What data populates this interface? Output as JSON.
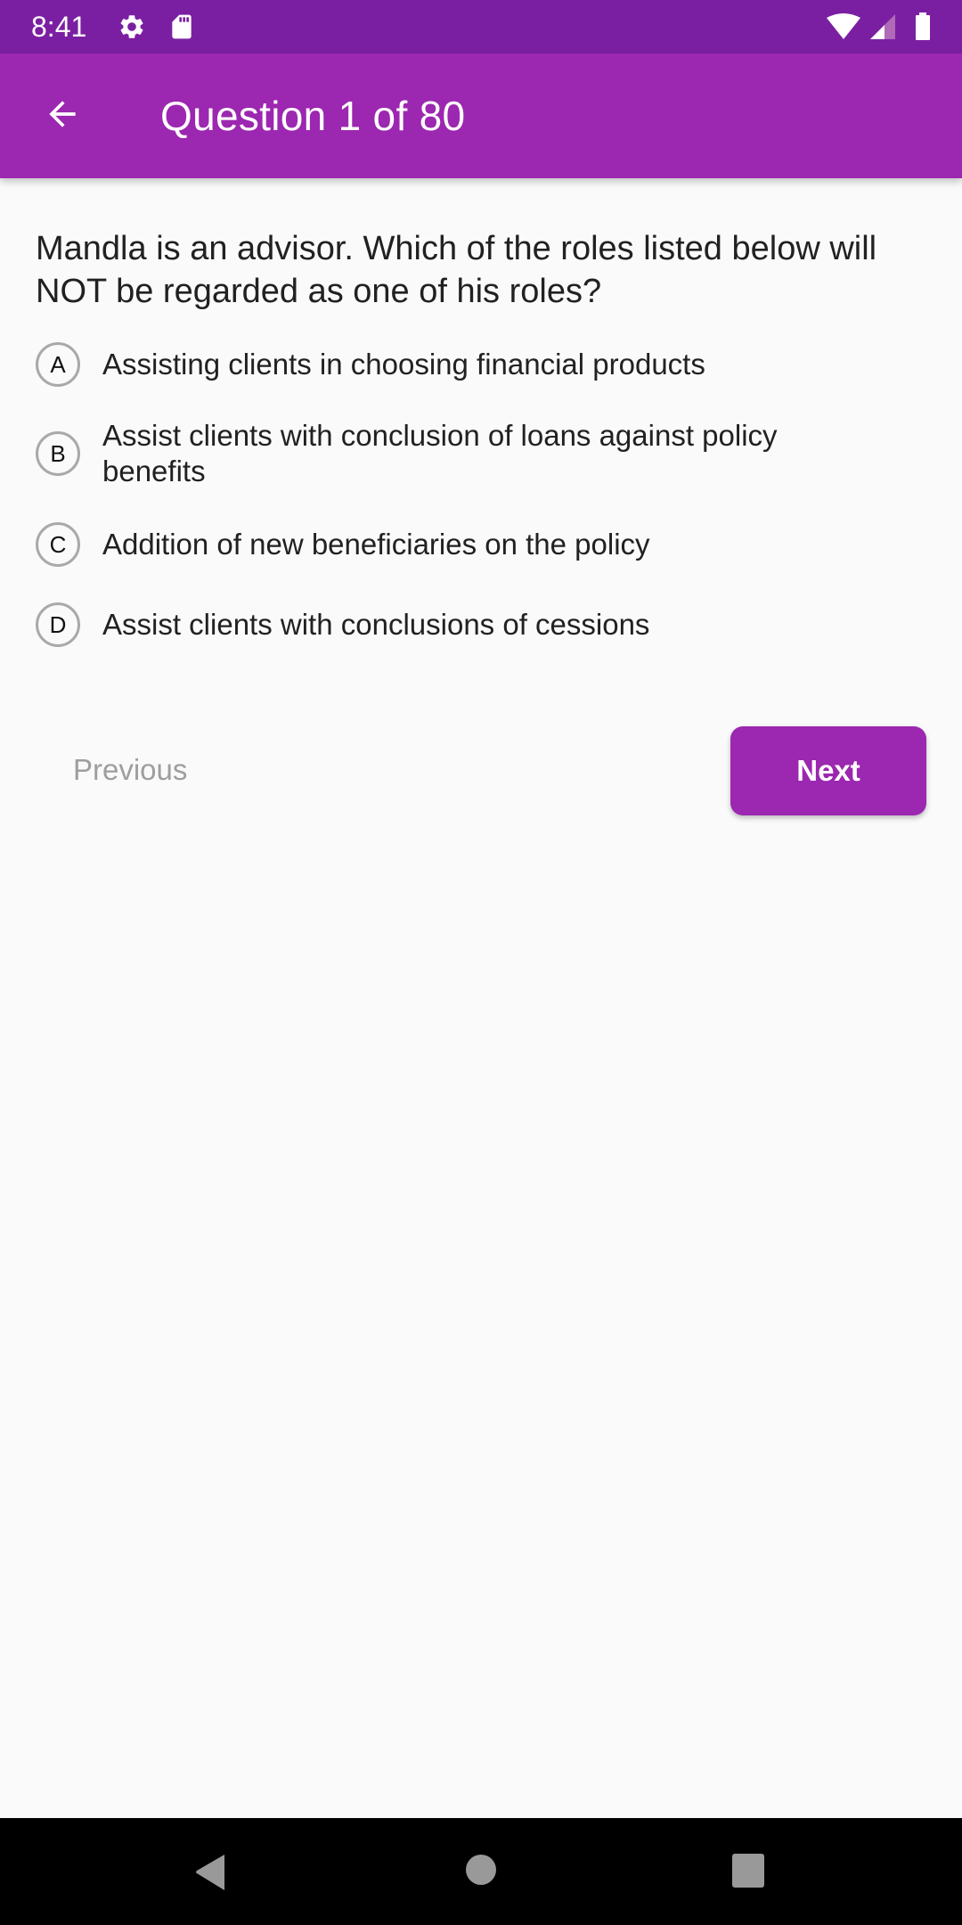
{
  "status_bar": {
    "time": "8:41",
    "left_icons": [
      "settings-icon",
      "sd-card-icon"
    ],
    "right_icons": [
      "wifi-icon",
      "cell-signal-icon",
      "battery-icon"
    ]
  },
  "app_bar": {
    "back_icon": "arrow-back-icon",
    "title": "Question 1 of 80"
  },
  "question": {
    "text": "Mandla is an advisor. Which of the roles listed below will NOT be regarded as one of his roles?",
    "options": [
      {
        "letter": "A",
        "label": "Assisting clients in choosing financial products"
      },
      {
        "letter": "B",
        "label": "Assist clients with conclusion of loans against policy benefits"
      },
      {
        "letter": "C",
        "label": "Addition of new beneficiaries on the policy"
      },
      {
        "letter": "D",
        "label": "Assist clients with conclusions of cessions"
      }
    ]
  },
  "navigation": {
    "previous_label": "Previous",
    "next_label": "Next",
    "previous_enabled": false
  },
  "system_nav": {
    "buttons": [
      "back",
      "home",
      "recents"
    ]
  },
  "colors": {
    "status_bar": "#7b1fa2",
    "primary": "#9c27b0",
    "background": "#fafafa",
    "disabled_text": "#9e9e9e"
  }
}
